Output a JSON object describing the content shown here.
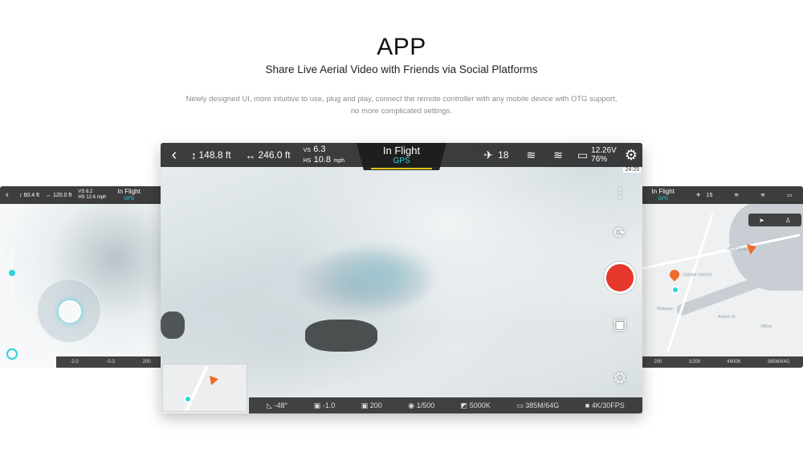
{
  "hero": {
    "title": "APP",
    "subtitle": "Share Live Aerial Video with Friends via Social Platforms",
    "desc_line1": "Newly designed UI, more intuitive to use, plug and play, connect the remote controller with any mobile device with OTG support,",
    "desc_line2": "no more complicated settings."
  },
  "left_screen": {
    "altitude": "60.4 ft",
    "distance": "120.0 ft",
    "vs": "8.2",
    "hs": "12.6 mph",
    "mode": "In Flight",
    "mode_sub": "GPS",
    "bottom": [
      "-2.0",
      "-0.3",
      "200"
    ]
  },
  "main_screen": {
    "altitude": "148.8 ft",
    "distance": "246.0 ft",
    "vs_label": "VS",
    "vs": "6.3",
    "hs_label": "HS",
    "hs": "10.8",
    "hs_unit": "mph",
    "mode": "In Flight",
    "mode_sub": "GPS",
    "satellites": "18",
    "voltage": "12.26V",
    "battery": "76%",
    "time_badge": "24:25",
    "bottom": {
      "pitch": "-48°",
      "ev": "-1.0",
      "iso": "200",
      "shutter": "1/500",
      "wb": "5000K",
      "storage": "385M/64G",
      "resolution": "4K/30FPS"
    }
  },
  "right_screen": {
    "mode": "In Flight",
    "mode_sub": "GPS",
    "satellites": "15",
    "bottom": [
      "200",
      "1/200",
      "4600K",
      "385M/64G"
    ],
    "map_labels": [
      "NEPONSET",
      "CEDAR GROVE",
      "Mattapan",
      "Milton",
      "Adams St"
    ]
  },
  "colors": {
    "accent_cyan": "#2fd3e0",
    "record_red": "#e5372b",
    "mode_underline": "#e0c21a",
    "drone_orange": "#f06a2a"
  }
}
